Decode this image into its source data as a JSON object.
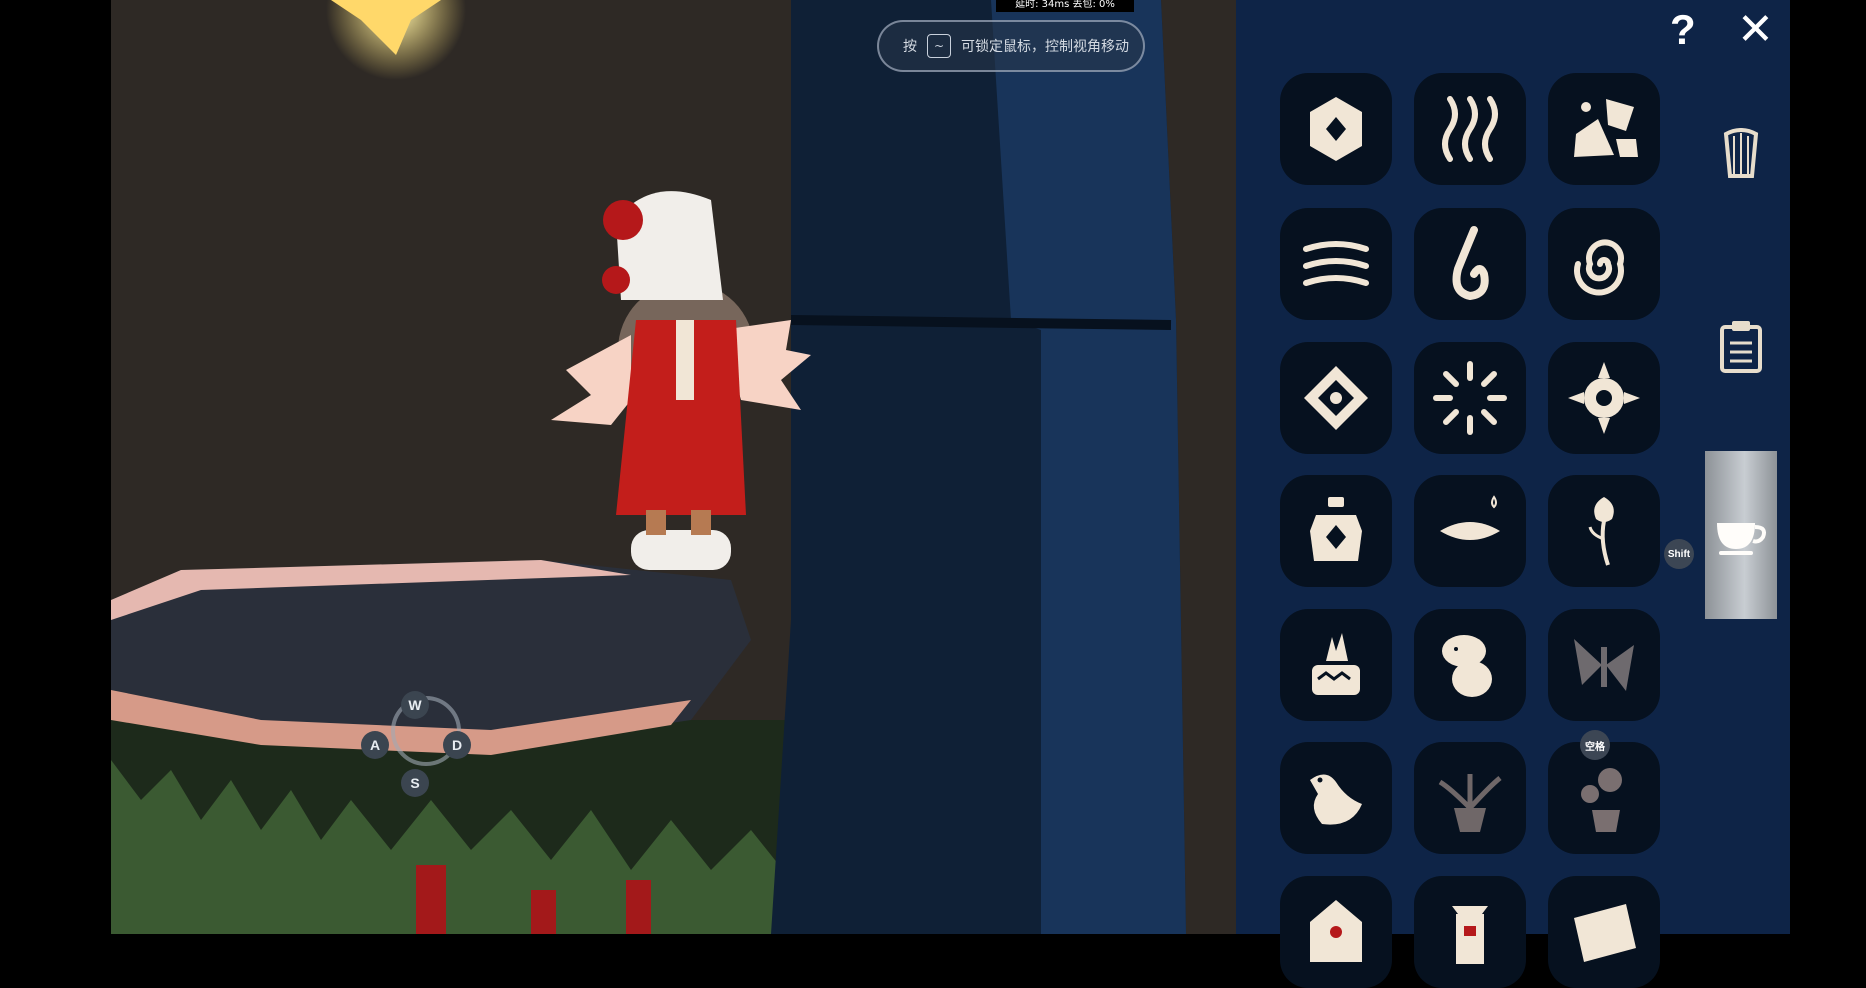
{
  "hint": {
    "prefix": "按",
    "key": "~",
    "text": "可锁定鼠标，控制视角移动"
  },
  "stats": "延时: 34ms   丢包: 0%",
  "movement_keys": {
    "up": "W",
    "left": "A",
    "right": "D",
    "down": "S"
  },
  "toolbar": {
    "help": "?",
    "close": "✕"
  },
  "side_tabs": [
    {
      "icon": "harp-icon",
      "active": false
    },
    {
      "icon": "clipboard-icon",
      "active": false
    },
    {
      "icon": "teacup-icon",
      "active": true
    }
  ],
  "badges": {
    "shift": "Shift",
    "space": "空格"
  },
  "emotes": [
    [
      "hexagon-gem-icon",
      "wavy-lines-icon",
      "rocks-icon"
    ],
    [
      "wind-icon",
      "flame-hook-icon",
      "spiral-icon"
    ],
    [
      "diamond-dot-icon",
      "sunburst-icon",
      "gear-sun-icon"
    ],
    [
      "bottle-icon",
      "pillow-icon",
      "rose-icon"
    ],
    [
      "crystal-cake-icon",
      "moomin-icon",
      "butterfly-icon"
    ],
    [
      "bird-icon",
      "plant-vase-icon",
      "sunflower-vase-icon"
    ],
    [
      "house-icon",
      "lantern-icon",
      "map-card-icon"
    ]
  ],
  "colors": {
    "panel": "#0e2447",
    "tile": "#06111f",
    "glyph": "#f1e6d6"
  }
}
